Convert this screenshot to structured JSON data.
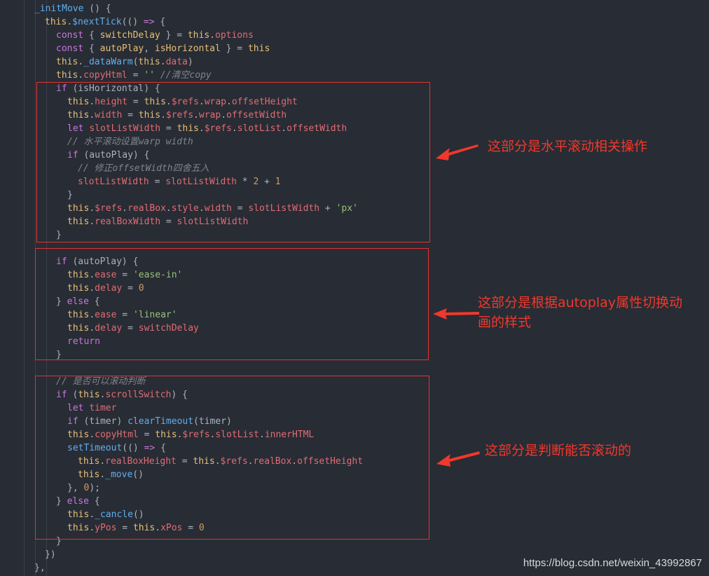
{
  "code_lines": [
    [
      [
        "fn",
        "_initMove"
      ],
      [
        "punc",
        " () {"
      ]
    ],
    [
      [
        "this",
        "this"
      ],
      [
        "punc",
        "."
      ],
      [
        "fn",
        "$nextTick"
      ],
      [
        "punc",
        "(() "
      ],
      [
        "kw",
        "=>"
      ],
      [
        "punc",
        " {"
      ]
    ],
    [
      [
        "kw",
        "const"
      ],
      [
        "punc",
        " { "
      ],
      [
        "this",
        "switchDelay"
      ],
      [
        "punc",
        " } = "
      ],
      [
        "this",
        "this"
      ],
      [
        "punc",
        "."
      ],
      [
        "prop",
        "options"
      ]
    ],
    [
      [
        "kw",
        "const"
      ],
      [
        "punc",
        " { "
      ],
      [
        "this",
        "autoPlay"
      ],
      [
        "punc",
        ", "
      ],
      [
        "this",
        "isHorizontal"
      ],
      [
        "punc",
        " } = "
      ],
      [
        "this",
        "this"
      ]
    ],
    [
      [
        "this",
        "this"
      ],
      [
        "punc",
        "."
      ],
      [
        "fn",
        "_dataWarm"
      ],
      [
        "punc",
        "("
      ],
      [
        "this",
        "this"
      ],
      [
        "punc",
        "."
      ],
      [
        "prop",
        "data"
      ],
      [
        "punc",
        ")"
      ]
    ],
    [
      [
        "this",
        "this"
      ],
      [
        "punc",
        "."
      ],
      [
        "prop",
        "copyHtml"
      ],
      [
        "punc",
        " = "
      ],
      [
        "str",
        "''"
      ],
      [
        "punc",
        " "
      ],
      [
        "cm",
        "//清空copy"
      ]
    ],
    [
      [
        "kw",
        "if"
      ],
      [
        "punc",
        " (isHorizontal) {"
      ]
    ],
    [
      [
        "this",
        "this"
      ],
      [
        "punc",
        "."
      ],
      [
        "prop",
        "height"
      ],
      [
        "punc",
        " = "
      ],
      [
        "this",
        "this"
      ],
      [
        "punc",
        "."
      ],
      [
        "prop",
        "$refs"
      ],
      [
        "punc",
        "."
      ],
      [
        "prop",
        "wrap"
      ],
      [
        "punc",
        "."
      ],
      [
        "prop",
        "offsetHeight"
      ]
    ],
    [
      [
        "this",
        "this"
      ],
      [
        "punc",
        "."
      ],
      [
        "prop",
        "width"
      ],
      [
        "punc",
        " = "
      ],
      [
        "this",
        "this"
      ],
      [
        "punc",
        "."
      ],
      [
        "prop",
        "$refs"
      ],
      [
        "punc",
        "."
      ],
      [
        "prop",
        "wrap"
      ],
      [
        "punc",
        "."
      ],
      [
        "prop",
        "offsetWidth"
      ]
    ],
    [
      [
        "kw",
        "let"
      ],
      [
        "punc",
        " "
      ],
      [
        "prop",
        "slotListWidth"
      ],
      [
        "punc",
        " = "
      ],
      [
        "this",
        "this"
      ],
      [
        "punc",
        "."
      ],
      [
        "prop",
        "$refs"
      ],
      [
        "punc",
        "."
      ],
      [
        "prop",
        "slotList"
      ],
      [
        "punc",
        "."
      ],
      [
        "prop",
        "offsetWidth"
      ]
    ],
    [
      [
        "cm",
        "// 水平滚动设置warp width"
      ]
    ],
    [
      [
        "kw",
        "if"
      ],
      [
        "punc",
        " (autoPlay) {"
      ]
    ],
    [
      [
        "cm",
        "// 修正offsetWidth四舍五入"
      ]
    ],
    [
      [
        "prop",
        "slotListWidth"
      ],
      [
        "punc",
        " = "
      ],
      [
        "prop",
        "slotListWidth"
      ],
      [
        "punc",
        " * "
      ],
      [
        "num",
        "2"
      ],
      [
        "punc",
        " + "
      ],
      [
        "num",
        "1"
      ]
    ],
    [
      [
        "punc",
        "}"
      ]
    ],
    [
      [
        "this",
        "this"
      ],
      [
        "punc",
        "."
      ],
      [
        "prop",
        "$refs"
      ],
      [
        "punc",
        "."
      ],
      [
        "prop",
        "realBox"
      ],
      [
        "punc",
        "."
      ],
      [
        "prop",
        "style"
      ],
      [
        "punc",
        "."
      ],
      [
        "prop",
        "width"
      ],
      [
        "punc",
        " = "
      ],
      [
        "prop",
        "slotListWidth"
      ],
      [
        "punc",
        " + "
      ],
      [
        "str",
        "'px'"
      ]
    ],
    [
      [
        "this",
        "this"
      ],
      [
        "punc",
        "."
      ],
      [
        "prop",
        "realBoxWidth"
      ],
      [
        "punc",
        " = "
      ],
      [
        "prop",
        "slotListWidth"
      ]
    ],
    [
      [
        "punc",
        "}"
      ]
    ],
    [],
    [
      [
        "kw",
        "if"
      ],
      [
        "punc",
        " (autoPlay) {"
      ]
    ],
    [
      [
        "this",
        "this"
      ],
      [
        "punc",
        "."
      ],
      [
        "prop",
        "ease"
      ],
      [
        "punc",
        " = "
      ],
      [
        "str",
        "'ease-in'"
      ]
    ],
    [
      [
        "this",
        "this"
      ],
      [
        "punc",
        "."
      ],
      [
        "prop",
        "delay"
      ],
      [
        "punc",
        " = "
      ],
      [
        "num",
        "0"
      ]
    ],
    [
      [
        "punc",
        "} "
      ],
      [
        "kw",
        "else"
      ],
      [
        "punc",
        " {"
      ]
    ],
    [
      [
        "this",
        "this"
      ],
      [
        "punc",
        "."
      ],
      [
        "prop",
        "ease"
      ],
      [
        "punc",
        " = "
      ],
      [
        "str",
        "'linear'"
      ]
    ],
    [
      [
        "this",
        "this"
      ],
      [
        "punc",
        "."
      ],
      [
        "prop",
        "delay"
      ],
      [
        "punc",
        " = "
      ],
      [
        "prop",
        "switchDelay"
      ]
    ],
    [
      [
        "kw",
        "return"
      ]
    ],
    [
      [
        "punc",
        "}"
      ]
    ],
    [],
    [
      [
        "cm",
        "// 是否可以滚动判断"
      ]
    ],
    [
      [
        "kw",
        "if"
      ],
      [
        "punc",
        " ("
      ],
      [
        "this",
        "this"
      ],
      [
        "punc",
        "."
      ],
      [
        "prop",
        "scrollSwitch"
      ],
      [
        "punc",
        ") {"
      ]
    ],
    [
      [
        "kw",
        "let"
      ],
      [
        "punc",
        " "
      ],
      [
        "prop",
        "timer"
      ]
    ],
    [
      [
        "kw",
        "if"
      ],
      [
        "punc",
        " (timer) "
      ],
      [
        "fn",
        "clearTimeout"
      ],
      [
        "punc",
        "(timer)"
      ]
    ],
    [
      [
        "this",
        "this"
      ],
      [
        "punc",
        "."
      ],
      [
        "prop",
        "copyHtml"
      ],
      [
        "punc",
        " = "
      ],
      [
        "this",
        "this"
      ],
      [
        "punc",
        "."
      ],
      [
        "prop",
        "$refs"
      ],
      [
        "punc",
        "."
      ],
      [
        "prop",
        "slotList"
      ],
      [
        "punc",
        "."
      ],
      [
        "prop",
        "innerHTML"
      ]
    ],
    [
      [
        "fn",
        "setTimeout"
      ],
      [
        "punc",
        "(() "
      ],
      [
        "kw",
        "=>"
      ],
      [
        "punc",
        " {"
      ]
    ],
    [
      [
        "this",
        "this"
      ],
      [
        "punc",
        "."
      ],
      [
        "prop",
        "realBoxHeight"
      ],
      [
        "punc",
        " = "
      ],
      [
        "this",
        "this"
      ],
      [
        "punc",
        "."
      ],
      [
        "prop",
        "$refs"
      ],
      [
        "punc",
        "."
      ],
      [
        "prop",
        "realBox"
      ],
      [
        "punc",
        "."
      ],
      [
        "prop",
        "offsetHeight"
      ]
    ],
    [
      [
        "this",
        "this"
      ],
      [
        "punc",
        "."
      ],
      [
        "fn",
        "_move"
      ],
      [
        "punc",
        "()"
      ]
    ],
    [
      [
        "punc",
        "}, "
      ],
      [
        "num",
        "0"
      ],
      [
        "punc",
        ");"
      ]
    ],
    [
      [
        "punc",
        "} "
      ],
      [
        "kw",
        "else"
      ],
      [
        "punc",
        " {"
      ]
    ],
    [
      [
        "this",
        "this"
      ],
      [
        "punc",
        "."
      ],
      [
        "fn",
        "_cancle"
      ],
      [
        "punc",
        "()"
      ]
    ],
    [
      [
        "this",
        "this"
      ],
      [
        "punc",
        "."
      ],
      [
        "prop",
        "yPos"
      ],
      [
        "punc",
        " = "
      ],
      [
        "this",
        "this"
      ],
      [
        "punc",
        "."
      ],
      [
        "prop",
        "xPos"
      ],
      [
        "punc",
        " = "
      ],
      [
        "num",
        "0"
      ]
    ],
    [
      [
        "punc",
        "}"
      ]
    ],
    [
      [
        "punc",
        "})"
      ]
    ],
    [
      [
        "punc",
        "},"
      ]
    ]
  ],
  "annotations": {
    "horizontal": "这部分是水平滚动相关操作",
    "autoplay_line1": "这部分是根据autoplay属性切换动",
    "autoplay_line2": "画的样式",
    "scroll": "这部分是判断能否滚动的"
  },
  "watermark": "https://blog.csdn.net/weixin_43992867",
  "colors": {
    "background": "#282c34",
    "keyword": "#c678dd",
    "this": "#e5c07b",
    "property": "#e06c75",
    "function": "#61afef",
    "string": "#98c379",
    "number": "#d19a66",
    "comment": "#7f848e",
    "annotation": "#f0382c"
  }
}
